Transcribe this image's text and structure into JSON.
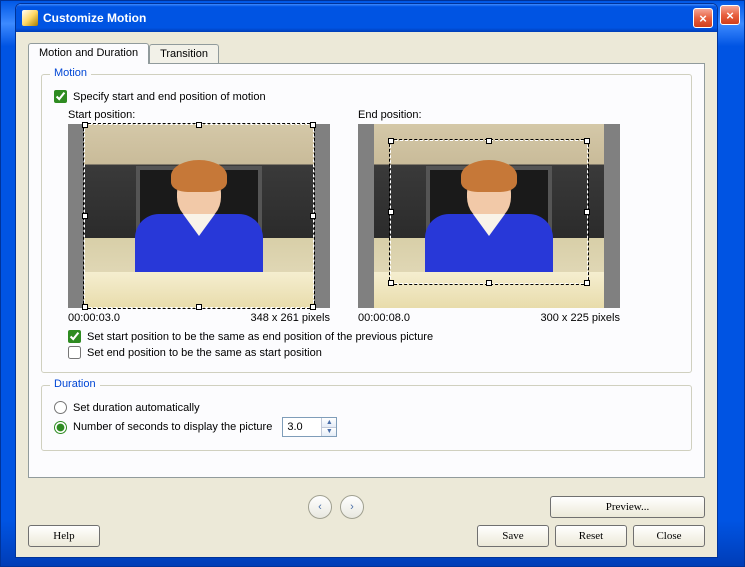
{
  "window": {
    "title": "Customize Motion"
  },
  "tabs": {
    "motion": "Motion and Duration",
    "transition": "Transition"
  },
  "motion": {
    "group_title": "Motion",
    "specify_label": "Specify start and end position of motion",
    "specify_checked": true,
    "start": {
      "label": "Start position:",
      "timestamp": "00:00:03.0",
      "dims": "348 x 261 pixels"
    },
    "end": {
      "label": "End position:",
      "timestamp": "00:00:08.0",
      "dims": "300 x 225 pixels"
    },
    "set_start_label": "Set start position to be the same as end position of the previous picture",
    "set_start_checked": true,
    "set_end_label": "Set end position to be the same as start position",
    "set_end_checked": false
  },
  "duration": {
    "group_title": "Duration",
    "auto_label": "Set duration automatically",
    "seconds_label": "Number of seconds to display the picture",
    "selected": "seconds",
    "value": "3.0"
  },
  "buttons": {
    "preview": "Preview...",
    "help": "Help",
    "save": "Save",
    "reset": "Reset",
    "close": "Close"
  }
}
